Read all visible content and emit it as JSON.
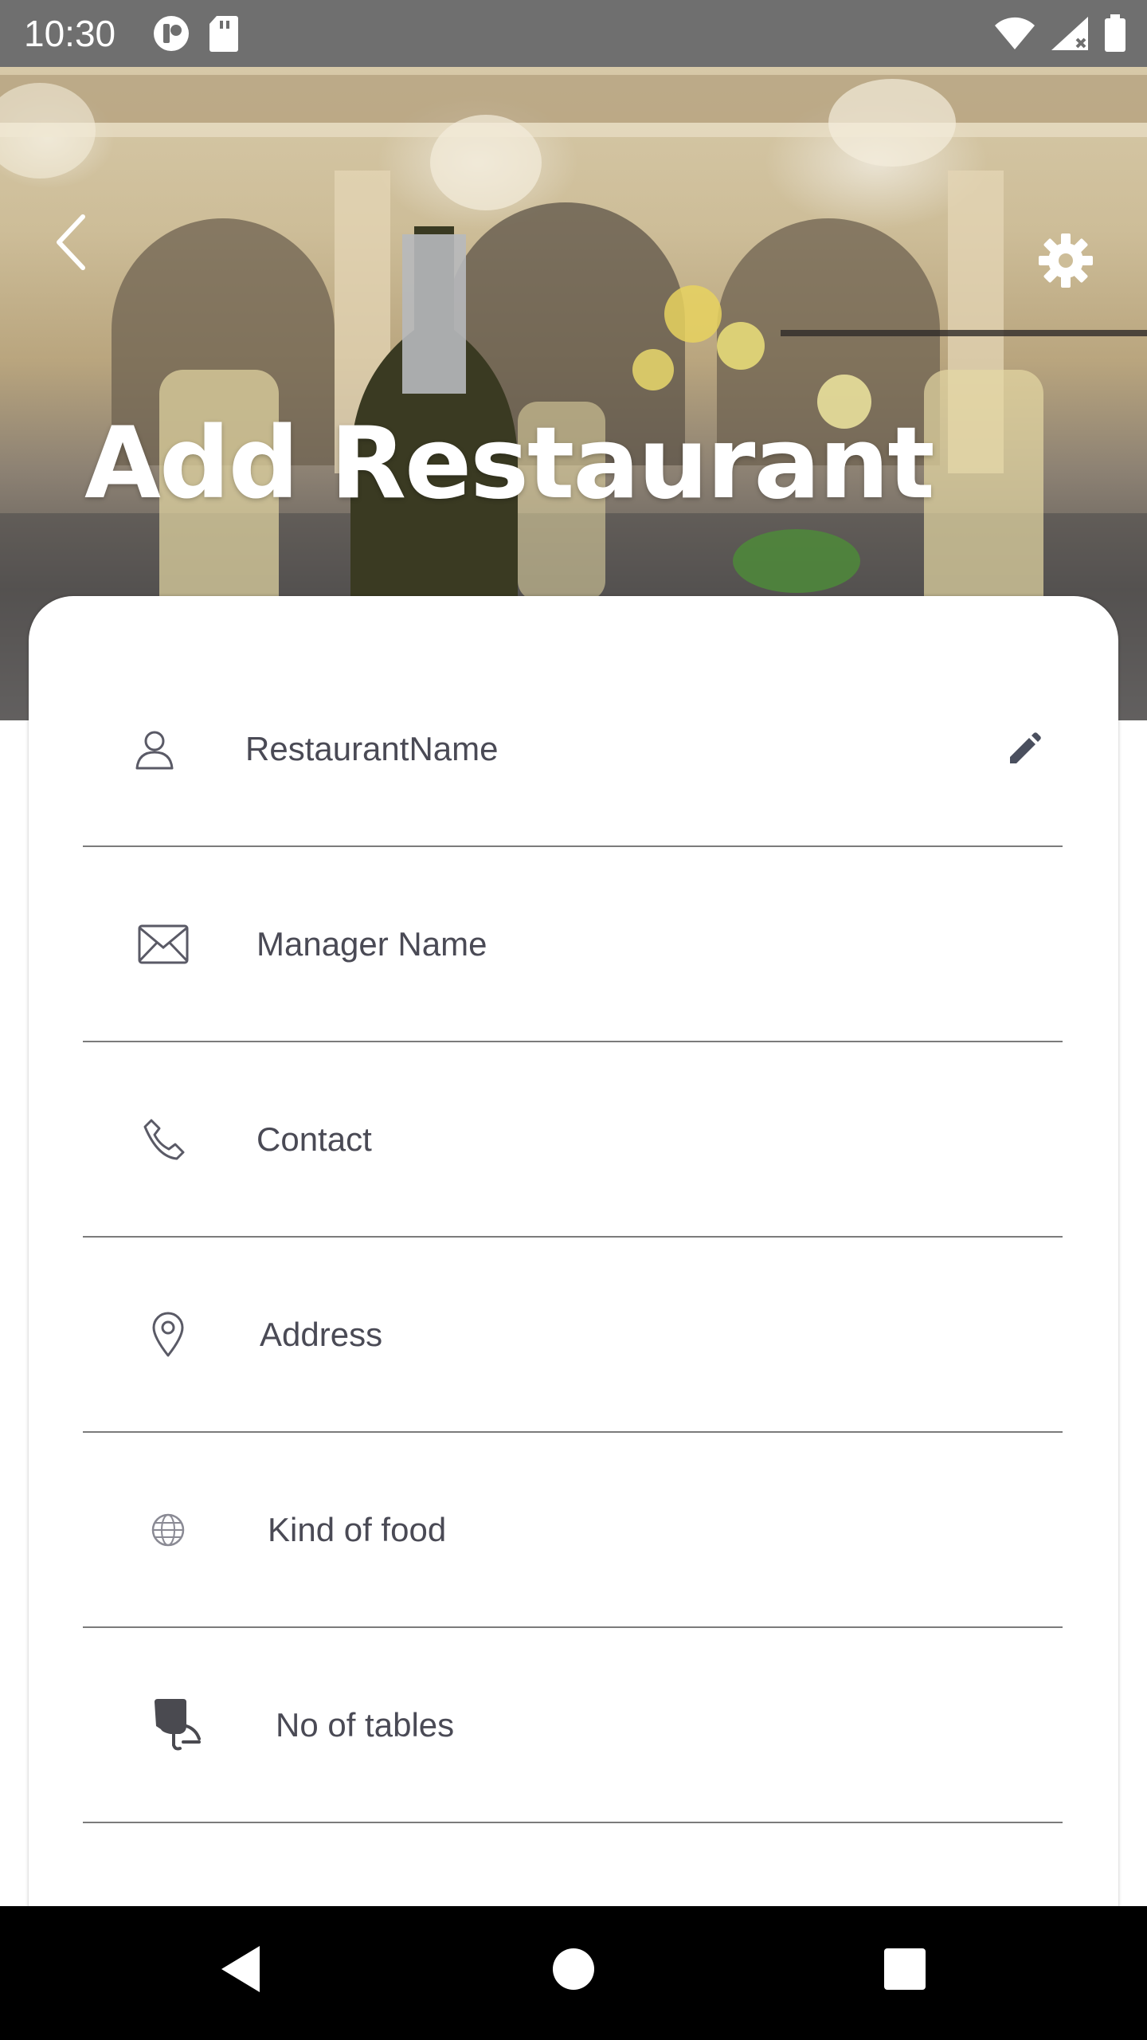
{
  "status_bar": {
    "time": "10:30"
  },
  "header": {
    "title": "Add Restaurant",
    "back_icon": "chevron-left-icon",
    "settings_icon": "gear-icon"
  },
  "form": {
    "fields": [
      {
        "placeholder": "RestaurantName",
        "icon": "person-icon"
      },
      {
        "placeholder": "Manager Name",
        "icon": "mail-icon"
      },
      {
        "placeholder": "Contact",
        "icon": "phone-icon"
      },
      {
        "placeholder": "Address",
        "icon": "location-pin-icon"
      },
      {
        "placeholder": "Kind of food",
        "icon": "globe-icon"
      },
      {
        "placeholder": "No of tables",
        "icon": "table-icon"
      }
    ],
    "edit_icon": "pencil-icon"
  },
  "nav": {
    "back": "triangle-back-icon",
    "home": "circle-home-icon",
    "recents": "square-recents-icon"
  }
}
